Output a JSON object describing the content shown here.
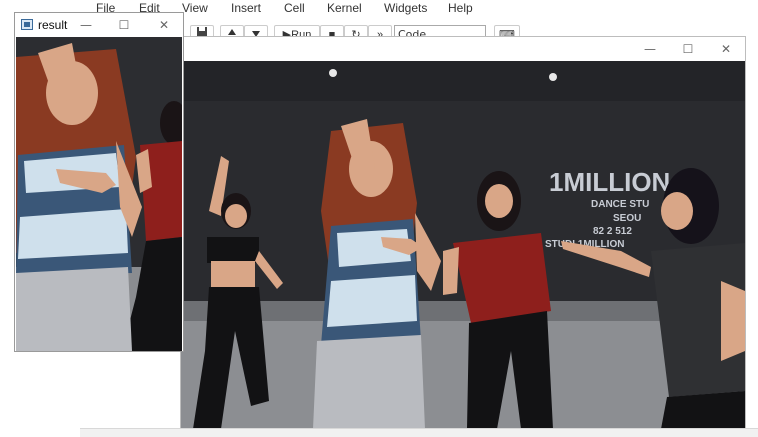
{
  "menubar": {
    "items": [
      "File",
      "Edit",
      "View",
      "Insert",
      "Cell",
      "Kernel",
      "Widgets",
      "Help"
    ]
  },
  "toolbar": {
    "run_label": "Run",
    "cell_type": "Code"
  },
  "result_window": {
    "title": "result",
    "minimize": "—",
    "maximize": "☐",
    "close": "✕"
  },
  "video_window": {
    "minimize": "—",
    "maximize": "☐",
    "close": "✕"
  },
  "video_frame": {
    "wall_text_main": "1MILLION",
    "wall_text_line1": "DANCE STU",
    "wall_text_line2": "SEOU",
    "wall_text_line3": "82 2 512",
    "wall_text_line4": "STUDI 1MILLION"
  },
  "colors": {
    "studio_wall": "#2a2b2f",
    "floor": "#8c8e92",
    "skin": "#d9a687",
    "hair_red": "#8a3a22",
    "red_shirt": "#8e1f1c",
    "sweatpants": "#b9bbc0",
    "black": "#121214"
  }
}
